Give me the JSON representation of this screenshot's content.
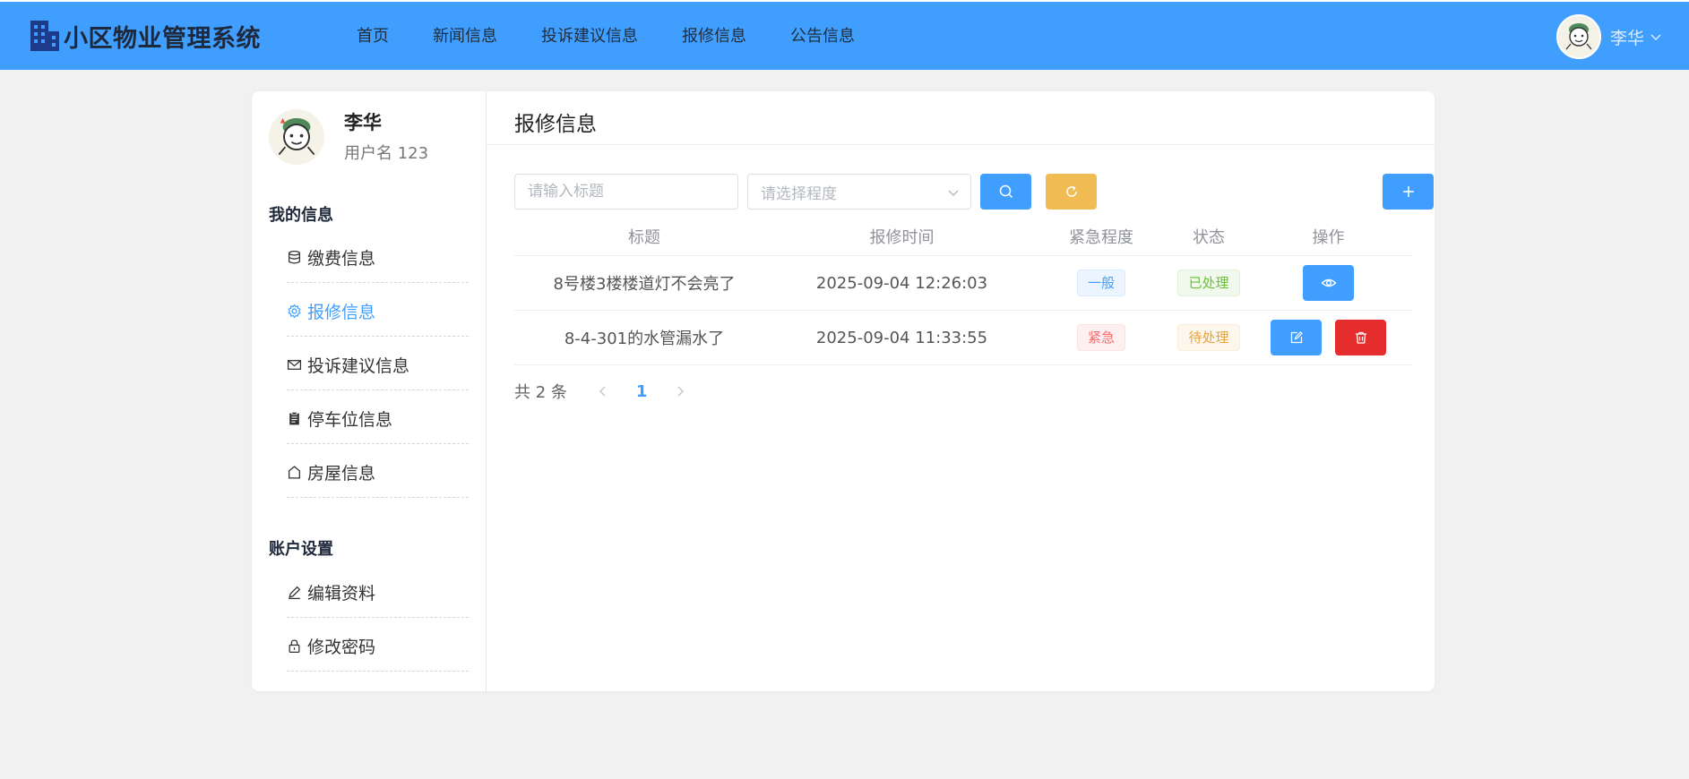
{
  "app": {
    "title": "小区物业管理系统"
  },
  "nav": [
    {
      "label": "首页"
    },
    {
      "label": "新闻信息"
    },
    {
      "label": "投诉建议信息"
    },
    {
      "label": "报修信息"
    },
    {
      "label": "公告信息"
    }
  ],
  "user": {
    "name": "李华",
    "username_line": "用户名 123"
  },
  "sidebar": {
    "section_my": "我的信息",
    "my_items": [
      {
        "label": "缴费信息",
        "icon": "database-icon",
        "active": false
      },
      {
        "label": "报修信息",
        "icon": "gear-icon",
        "active": true
      },
      {
        "label": "投诉建议信息",
        "icon": "mail-icon",
        "active": false
      },
      {
        "label": "停车位信息",
        "icon": "clipboard-icon",
        "active": false
      },
      {
        "label": "房屋信息",
        "icon": "house-icon",
        "active": false
      }
    ],
    "section_account": "账户设置",
    "account_items": [
      {
        "label": "编辑资料",
        "icon": "pen-icon"
      },
      {
        "label": "修改密码",
        "icon": "lock-icon"
      }
    ]
  },
  "content": {
    "title": "报修信息",
    "search_placeholder": "请输入标题",
    "level_select_placeholder": "请选择程度"
  },
  "table": {
    "headers": [
      "标题",
      "报修时间",
      "紧急程度",
      "状态",
      "操作"
    ],
    "rows": [
      {
        "title": "8号楼3楼楼道灯不会亮了",
        "time": "2025-09-04 12:26:03",
        "level": "一般",
        "status": "已处理"
      },
      {
        "title": "8-4-301的水管漏水了",
        "time": "2025-09-04 11:33:55",
        "level": "紧急",
        "status": "待处理"
      }
    ]
  },
  "pagination": {
    "total": "共 2 条",
    "current": "1"
  },
  "colors": {
    "primary": "#409eff",
    "warning": "#f2bc55",
    "danger": "#e52d2d"
  }
}
